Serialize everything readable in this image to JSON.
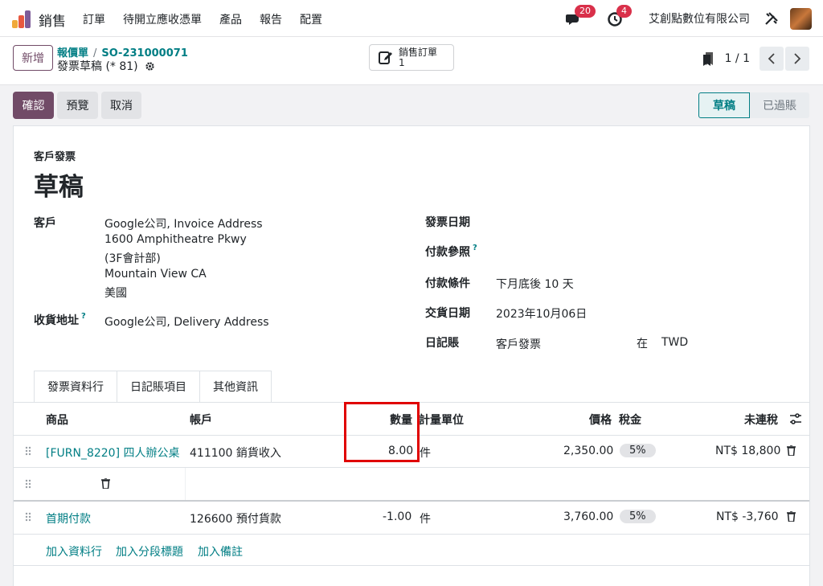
{
  "nav": {
    "app_name": "銷售",
    "menu": [
      "訂單",
      "待開立應收憑單",
      "產品",
      "報告",
      "配置"
    ],
    "messages_count": "20",
    "activities_count": "4",
    "company": "艾創點數位有限公司"
  },
  "breadcrumb": {
    "new_label": "新增",
    "parent1": "報價單",
    "separator": "/",
    "parent2": "SO-231000071",
    "current": "發票草稿 (* 81)",
    "smart_button": {
      "line1": "銷售訂單",
      "line2": "1"
    },
    "pager": "1 / 1"
  },
  "actions": {
    "confirm": "確認",
    "preview": "預覽",
    "cancel": "取消"
  },
  "status": {
    "active": "草稿",
    "next": "已過賬"
  },
  "form": {
    "doc_type": "客戶發票",
    "title": "草稿",
    "customer_label": "客戶",
    "customer_lines": [
      "Google公司, Invoice Address",
      "1600 Amphitheatre Pkwy",
      "(3F會計部)",
      "Mountain View CA",
      "美國"
    ],
    "delivery_label": "收貨地址",
    "delivery_value": "Google公司, Delivery Address",
    "help_mark": "?",
    "invoice_date_label": "發票日期",
    "payment_ref_label": "付款參照",
    "payment_terms_label": "付款條件",
    "payment_terms_value": "下月底後 10 天",
    "delivery_date_label": "交貨日期",
    "delivery_date_value": "2023年10月06日",
    "journal_label": "日記賬",
    "journal_value": "客戶發票",
    "journal_in": "在",
    "currency": "TWD"
  },
  "tabs": [
    "發票資料行",
    "日記賬項目",
    "其他資訊"
  ],
  "table": {
    "headers": {
      "product": "商品",
      "account": "帳戶",
      "quantity": "數量",
      "uom": "計量單位",
      "price": "價格",
      "tax": "稅金",
      "subtotal": "未連稅"
    },
    "rows": [
      {
        "product": "[FURN_8220] 四人辦公桌",
        "account": "411100 銷貨收入",
        "quantity": "8.00",
        "uom": "件",
        "price": "2,350.00",
        "tax": "5%",
        "subtotal": "NT$ 18,800"
      },
      {
        "product": "首期付款",
        "account": "126600 預付貨款",
        "quantity": "-1.00",
        "uom": "件",
        "price": "3,760.00",
        "tax": "5%",
        "subtotal": "NT$ -3,760"
      }
    ],
    "add_line": "加入資料行",
    "add_section": "加入分段標題",
    "add_note": "加入備註"
  },
  "colors": {
    "brand": "#714b67",
    "link": "#017e84",
    "badge": "#d9304a",
    "highlight": "#e00000"
  }
}
